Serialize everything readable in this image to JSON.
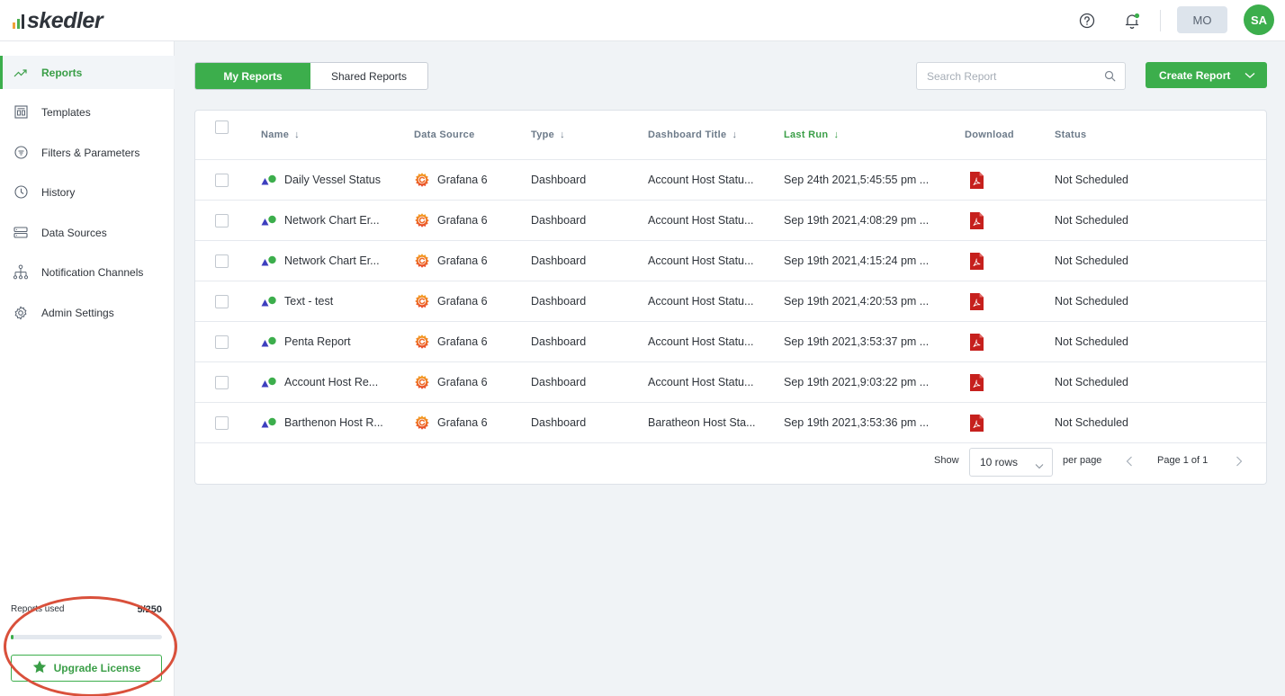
{
  "app": {
    "logo_text": "skedler"
  },
  "header": {
    "org_initials": "MO",
    "user_initials": "SA",
    "accent": "#3cae4c"
  },
  "sidebar": {
    "items": [
      {
        "label": "Reports",
        "icon": "trend-line-icon",
        "active": true
      },
      {
        "label": "Templates",
        "icon": "template-icon"
      },
      {
        "label": "Filters & Parameters",
        "icon": "filter-icon"
      },
      {
        "label": "History",
        "icon": "clock-icon"
      },
      {
        "label": "Data Sources",
        "icon": "database-icon"
      },
      {
        "label": "Notification Channels",
        "icon": "hierarchy-icon"
      },
      {
        "label": "Admin Settings",
        "icon": "gear-icon"
      }
    ],
    "usage": {
      "label": "Reports used",
      "count": "5/250",
      "used": 5,
      "total": 250
    },
    "upgrade_label": "Upgrade License"
  },
  "toolbar": {
    "tabs": [
      {
        "label": "My Reports",
        "active": true
      },
      {
        "label": "Shared Reports",
        "active": false
      }
    ],
    "search_placeholder": "Search Report",
    "create_label": "Create Report"
  },
  "table": {
    "columns": {
      "name": "Name",
      "source": "Data Source",
      "type": "Type",
      "dashboard": "Dashboard Title",
      "last_run": "Last Run",
      "download": "Download",
      "status": "Status"
    },
    "rows": [
      {
        "name": "Daily Vessel Status",
        "source": "Grafana 6",
        "type": "Dashboard",
        "dashboard": "Account Host Statu...",
        "last_run": "Sep 24th 2021,5:45:55 pm ...",
        "status": "Not Scheduled"
      },
      {
        "name": "Network Chart Er...",
        "source": "Grafana 6",
        "type": "Dashboard",
        "dashboard": "Account Host Statu...",
        "last_run": "Sep 19th 2021,4:08:29 pm ...",
        "status": "Not Scheduled"
      },
      {
        "name": "Network Chart Er...",
        "source": "Grafana 6",
        "type": "Dashboard",
        "dashboard": "Account Host Statu...",
        "last_run": "Sep 19th 2021,4:15:24 pm ...",
        "status": "Not Scheduled"
      },
      {
        "name": "Text - test",
        "source": "Grafana 6",
        "type": "Dashboard",
        "dashboard": "Account Host Statu...",
        "last_run": "Sep 19th 2021,4:20:53 pm ...",
        "status": "Not Scheduled"
      },
      {
        "name": "Penta Report",
        "source": "Grafana 6",
        "type": "Dashboard",
        "dashboard": "Account Host Statu...",
        "last_run": "Sep 19th 2021,3:53:37 pm ...",
        "status": "Not Scheduled"
      },
      {
        "name": "Account Host Re...",
        "source": "Grafana 6",
        "type": "Dashboard",
        "dashboard": "Account Host Statu...",
        "last_run": "Sep 19th 2021,9:03:22 pm ...",
        "status": "Not Scheduled"
      },
      {
        "name": "Barthenon Host R...",
        "source": "Grafana 6",
        "type": "Dashboard",
        "dashboard": "Baratheon Host Sta...",
        "last_run": "Sep 19th 2021,3:53:36 pm ...",
        "status": "Not Scheduled"
      }
    ]
  },
  "pagination": {
    "show_label": "Show",
    "rows_value": "10 rows",
    "per_page_label": "per page",
    "page_info": "Page 1 of 1"
  }
}
